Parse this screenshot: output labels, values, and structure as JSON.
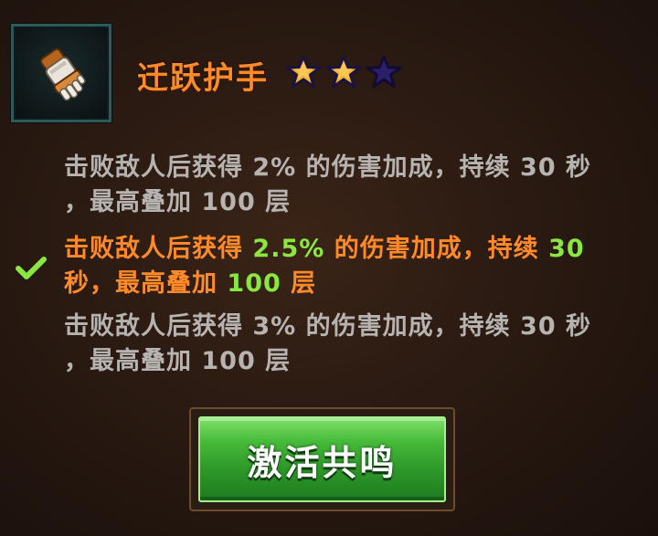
{
  "item": {
    "name": "迁跃护手",
    "icon": "gauntlet-icon",
    "stars_total": 3,
    "stars_filled": 2
  },
  "levels": [
    {
      "line1": "击败敌人后获得 2% 的伤害加成，持续 30 秒",
      "line2": "，最高叠加 100 层",
      "active": false
    },
    {
      "p1": "击败敌人后获得 ",
      "v1": "2.5%",
      "p2": " 的伤害加成，持续 ",
      "v2": "30",
      "p3": "秒，最高叠加 ",
      "v3": "100",
      "p4": " 层",
      "active": true
    },
    {
      "line1": "击败敌人后获得 3% 的伤害加成，持续 30 秒",
      "line2": "，最高叠加 100 层",
      "active": false
    }
  ],
  "button": {
    "label": "激活共鸣"
  },
  "colors": {
    "title": "#ff8a2a",
    "inactive_text": "#b6b3b0",
    "active_text": "#ff8a2a",
    "highlight": "#8ae640",
    "button_green": "#47bb3a",
    "star_gold": "#f2b233",
    "star_empty": "#2a1f6b"
  }
}
